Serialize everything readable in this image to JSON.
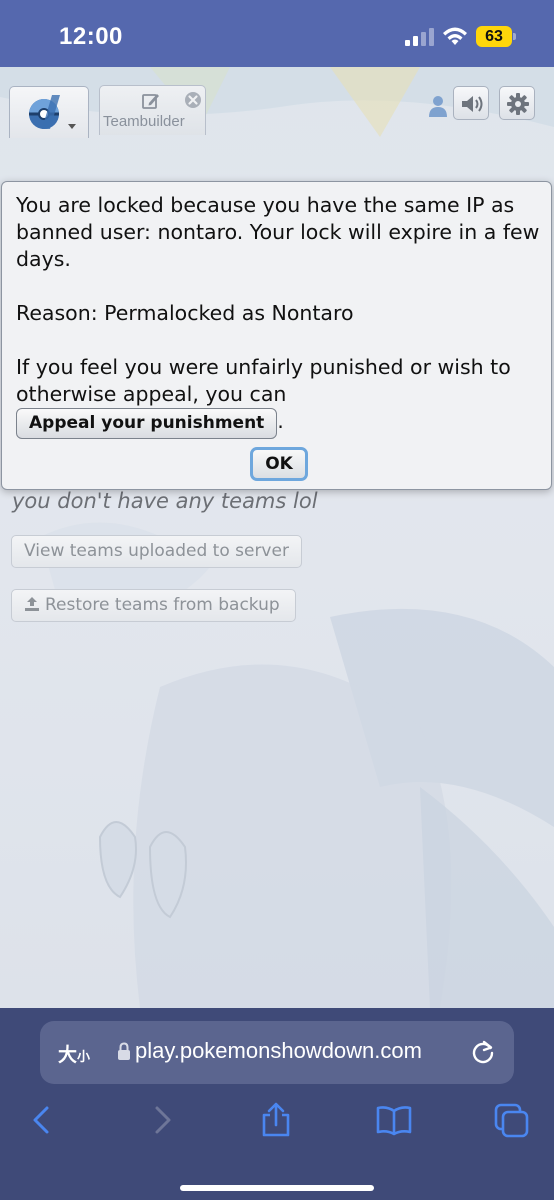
{
  "status_bar": {
    "time": "12:00",
    "battery_level": "63",
    "icons": [
      "signal-icon",
      "wifi-icon",
      "battery-icon"
    ]
  },
  "header": {
    "tabs": [
      {
        "label": "Teambuilder",
        "icon": "edit-icon",
        "close_icon": "close-icon"
      }
    ],
    "icons": [
      "logo-icon",
      "user-icon",
      "volume-icon",
      "gear-icon"
    ]
  },
  "teambuilder": {
    "empty_message": "you don't have any teams lol",
    "view_teams_label": "View teams uploaded to server",
    "restore_label": "Restore teams from backup"
  },
  "popup": {
    "message_line1": "You are locked because you have the same IP as banned user: nontaro. Your lock will expire in a few days.",
    "reason": "Reason: Permalocked as Nontaro",
    "appeal_text": "If you feel you were unfairly punished or wish to otherwise appeal, you can",
    "appeal_button_label": "Appeal your punishment",
    "appeal_period": ".",
    "ok_label": "OK"
  },
  "safari": {
    "text_size_large": "大",
    "text_size_small": "小",
    "url": "play.pokemonshowdown.com",
    "icons": [
      "lock-icon",
      "reload-icon",
      "back-icon",
      "forward-icon",
      "share-icon",
      "bookmarks-icon",
      "tabs-icon"
    ]
  },
  "colors": {
    "status_bar_bg": "#5568ae",
    "safari_bg": "#3f4a78",
    "battery": "#ffd60a",
    "ok_focus_ring": "#6ea7dd",
    "toolbar_icon": "#4a86f0"
  }
}
